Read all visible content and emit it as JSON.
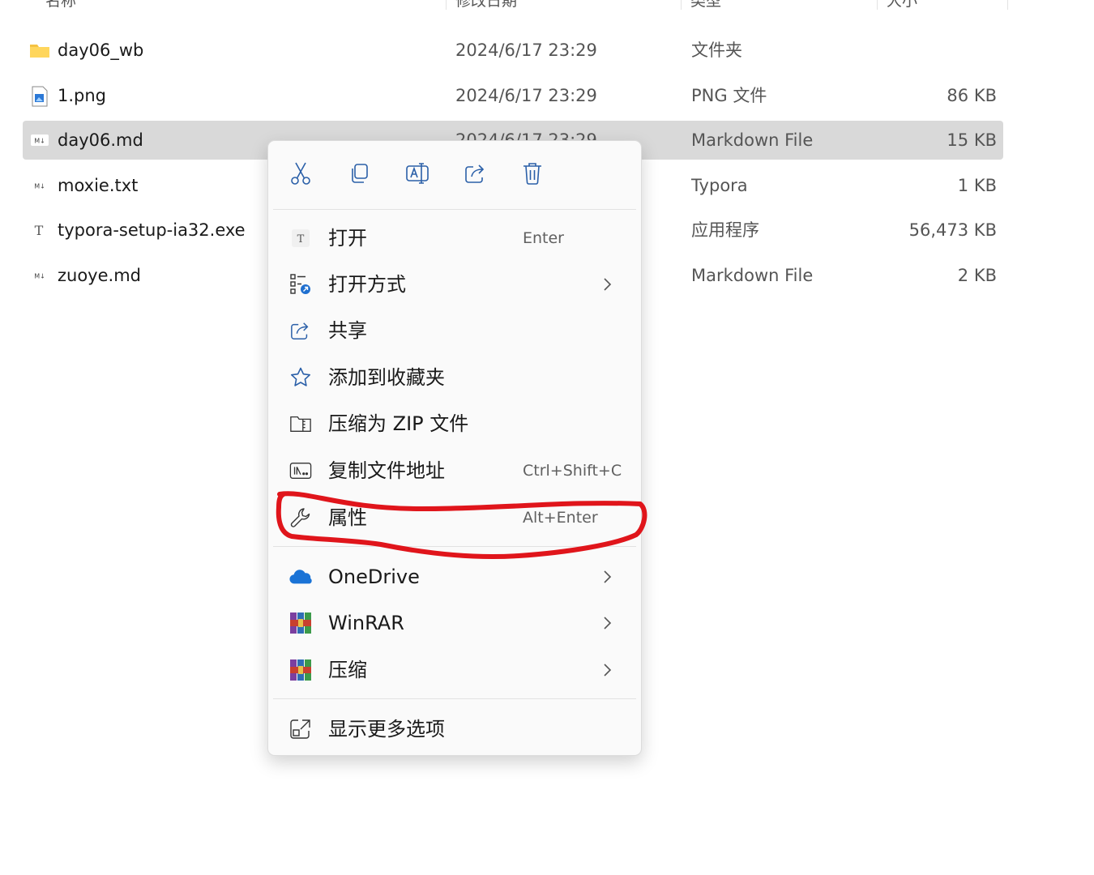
{
  "column_headers": {
    "name": "名称",
    "date": "修改日期",
    "type": "类型",
    "size": "大小"
  },
  "files": [
    {
      "name": "day06_wb",
      "date": "2024/6/17 23:29",
      "type": "文件夹",
      "size": "",
      "icon": "folder-icon",
      "selected": false
    },
    {
      "name": "1.png",
      "date": "2024/6/17 23:29",
      "type": "PNG 文件",
      "size": "86 KB",
      "icon": "png-file-icon",
      "selected": false
    },
    {
      "name": "day06.md",
      "date": "2024/6/17 23:29",
      "type": "Markdown File",
      "size": "15 KB",
      "icon": "markdown-file-icon",
      "selected": true
    },
    {
      "name": "moxie.txt",
      "date": "",
      "type": "Typora",
      "size": "1 KB",
      "icon": "markdown-file-icon",
      "selected": false
    },
    {
      "name": "typora-setup-ia32.exe",
      "date": "",
      "type": "应用程序",
      "size": "56,473 KB",
      "icon": "typora-exe-icon",
      "selected": false
    },
    {
      "name": "zuoye.md",
      "date": "",
      "type": "Markdown File",
      "size": "2 KB",
      "icon": "markdown-file-icon",
      "selected": false
    }
  ],
  "context_menu": {
    "quick_actions": [
      "cut-icon",
      "copy-icon",
      "rename-icon",
      "share-icon",
      "delete-icon"
    ],
    "items": [
      {
        "label": "打开",
        "shortcut": "Enter",
        "icon": "open-icon",
        "submenu": false
      },
      {
        "label": "打开方式",
        "shortcut": "",
        "icon": "open-with-icon",
        "submenu": true
      },
      {
        "label": "共享",
        "shortcut": "",
        "icon": "share-icon",
        "submenu": false
      },
      {
        "label": "添加到收藏夹",
        "shortcut": "",
        "icon": "star-icon",
        "submenu": false
      },
      {
        "label": "压缩为 ZIP 文件",
        "shortcut": "",
        "icon": "zip-icon",
        "submenu": false
      },
      {
        "label": "复制文件地址",
        "shortcut": "Ctrl+Shift+C",
        "icon": "copy-path-icon",
        "submenu": false
      },
      {
        "label": "属性",
        "shortcut": "Alt+Enter",
        "icon": "wrench-icon",
        "submenu": false
      },
      {
        "label": "OneDrive",
        "shortcut": "",
        "icon": "onedrive-icon",
        "submenu": true
      },
      {
        "label": "WinRAR",
        "shortcut": "",
        "icon": "winrar-icon",
        "submenu": true
      },
      {
        "label": "压缩",
        "shortcut": "",
        "icon": "winrar-icon",
        "submenu": true
      },
      {
        "label": "显示更多选项",
        "shortcut": "",
        "icon": "more-options-icon",
        "submenu": false
      }
    ]
  },
  "colors": {
    "selection": "#d9d9d9",
    "annotation": "#e0151b",
    "accent": "#1f6fcf"
  }
}
